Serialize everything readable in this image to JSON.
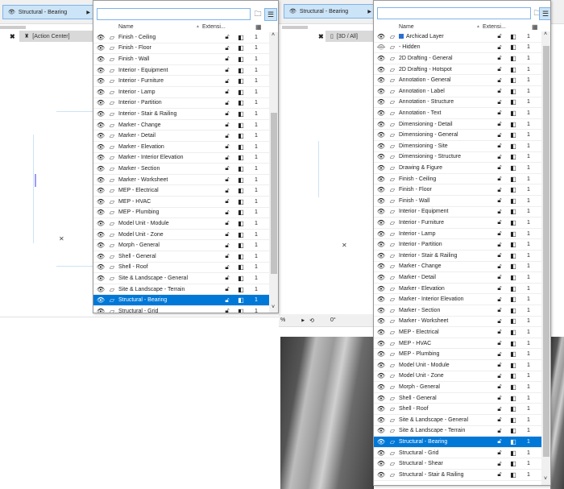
{
  "left": {
    "layer_button": "Structural - Bearing",
    "tab_label": "[Action Center]",
    "search": {
      "value": "",
      "placeholder": ""
    },
    "columns": {
      "name": "Name",
      "extension": "Extensi...",
      "sort": "▲"
    },
    "rows": [
      "Finish - Ceiling",
      "Finish - Floor",
      "Finish - Wall",
      "Interior - Equipment",
      "Interior - Furniture",
      "Interior - Lamp",
      "Interior - Partition",
      "Interior - Stair & Railing",
      "Marker - Change",
      "Marker - Detail",
      "Marker - Elevation",
      "Marker - Interior Elevation",
      "Marker - Section",
      "Marker - Worksheet",
      "MEP - Electrical",
      "MEP - HVAC",
      "MEP - Plumbing",
      "Model Unit - Module",
      "Model Unit - Zone",
      "Morph - General",
      "Shell - General",
      "Shell - Roof",
      "Site & Landscape - General",
      "Site & Landscape - Terrain",
      "Structural - Bearing",
      "Structural - Grid"
    ],
    "selected": "Structural - Bearing",
    "intersection_value": "1"
  },
  "right": {
    "layer_button": "Structural - Bearing",
    "tab_label": "[3D / All]",
    "search": {
      "value": "",
      "placeholder": ""
    },
    "columns": {
      "name": "Name",
      "extension": "Extensi...",
      "sort": "▲"
    },
    "rows": [
      "Archicad Layer",
      "- Hidden",
      "2D Drafting - General",
      "2D Drafting - Hotspot",
      "Annotation - General",
      "Annotation - Label",
      "Annotation - Structure",
      "Annotation - Text",
      "Dimensioning - Detail",
      "Dimensioning - General",
      "Dimensioning - Site",
      "Dimensioning - Structure",
      "Drawing & Figure",
      "Finish - Ceiling",
      "Finish - Floor",
      "Finish - Wall",
      "Interior - Equipment",
      "Interior - Furniture",
      "Interior - Lamp",
      "Interior - Partition",
      "Interior - Stair & Railing",
      "Marker - Change",
      "Marker - Detail",
      "Marker - Elevation",
      "Marker - Interior Elevation",
      "Marker - Section",
      "Marker - Worksheet",
      "MEP - Electrical",
      "MEP - HVAC",
      "MEP - Plumbing",
      "Model Unit - Module",
      "Model Unit - Zone",
      "Morph - General",
      "Shell - General",
      "Shell - Roof",
      "Site & Landscape - General",
      "Site & Landscape - Terrain",
      "Structural - Bearing",
      "Structural - Grid",
      "Structural - Shear",
      "Structural - Stair & Railing"
    ],
    "selected": "Structural - Bearing",
    "hidden_row": "- Hidden",
    "intersection_value": "1"
  },
  "toolbar": {
    "percent": "%",
    "angle": "0°"
  },
  "colors": {
    "selection": "#0078d7",
    "accent": "#7eb4ea"
  }
}
